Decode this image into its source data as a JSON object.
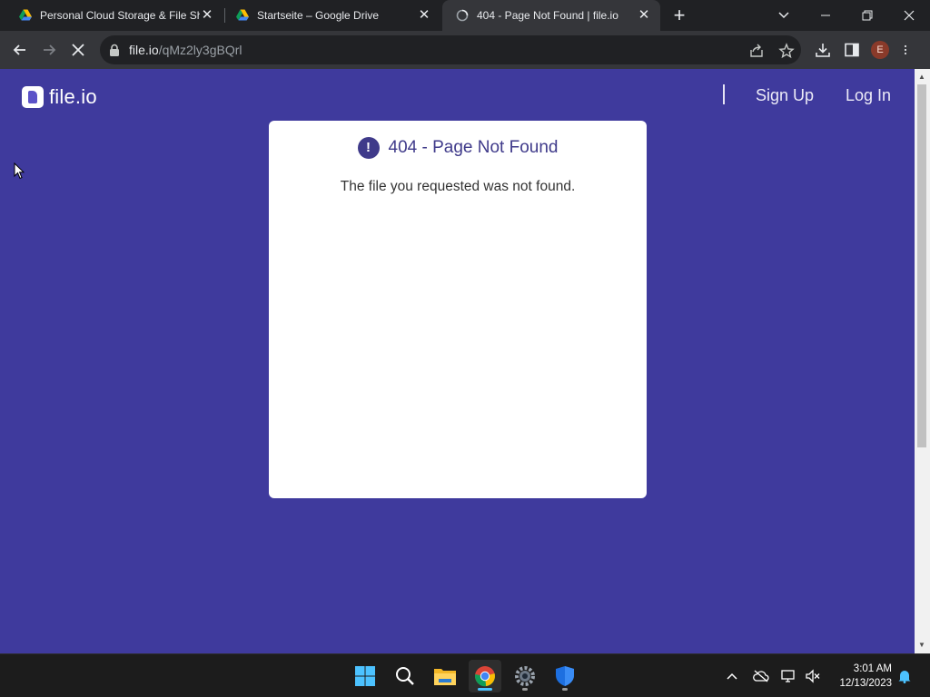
{
  "browser": {
    "tabs": [
      {
        "title": "Personal Cloud Storage & File Sh",
        "favicon": "google-drive-icon",
        "active": false
      },
      {
        "title": "Startseite – Google Drive",
        "favicon": "google-drive-icon",
        "active": false
      },
      {
        "title": "404 - Page Not Found | file.io",
        "favicon": "loading-globe-icon",
        "active": true
      }
    ],
    "tab_close_glyph": "✕",
    "new_tab_glyph": "+",
    "address": {
      "host": "file.io",
      "path": "/qMz2ly3gBQrl"
    },
    "profile_initial": "E"
  },
  "site": {
    "logo_text": "file.io",
    "nav": {
      "sign_up": "Sign Up",
      "log_in": "Log In"
    },
    "error": {
      "heading": "404 - Page Not Found",
      "alert_glyph": "!",
      "message": "The file you requested was not found."
    }
  },
  "taskbar": {
    "apps": [
      "start-icon",
      "search-icon",
      "file-explorer-icon",
      "chrome-icon",
      "settings-icon",
      "defender-icon"
    ],
    "time": "3:01 AM",
    "date": "12/13/2023"
  },
  "colors": {
    "page_background": "#3f3a9d",
    "accent": "#3f3a8a",
    "card": "#ffffff",
    "browser_frame": "#202124",
    "browser_toolbar": "#35363a"
  }
}
